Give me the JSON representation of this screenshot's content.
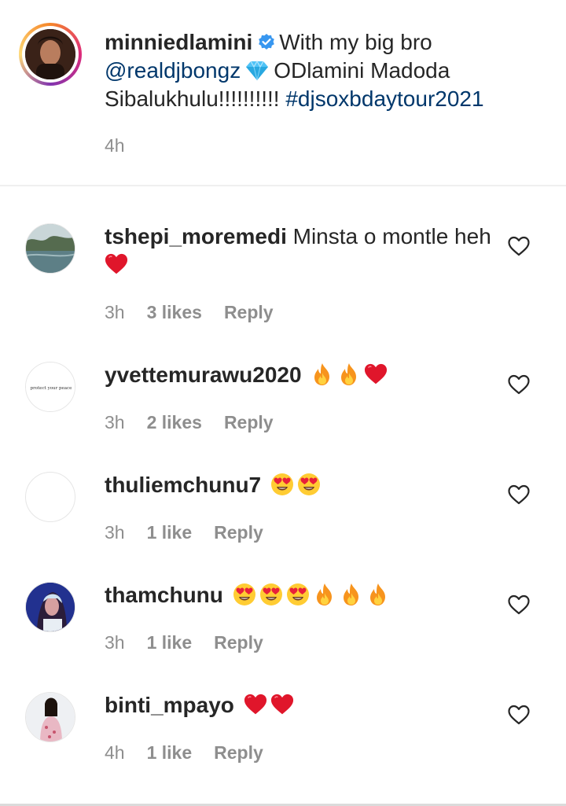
{
  "caption": {
    "username": "minniedlamini",
    "text_part1": "With my big bro",
    "mention": "@realdjbongz",
    "text_part2": "ODlamini Madoda Sibalukhulu!!!!!!!!!!",
    "hashtag": "#djsoxbdaytour2021",
    "time": "4h",
    "emoji": "gem-icon"
  },
  "comments": [
    {
      "username": "tshepi_moremedi",
      "text": "Minsta o montle heh",
      "emojis": [
        "red-heart-icon"
      ],
      "time": "3h",
      "likes": "3 likes",
      "reply": "Reply"
    },
    {
      "username": "yvettemurawu2020",
      "text": "",
      "emojis": [
        "fire-icon",
        "fire-icon",
        "red-heart-icon"
      ],
      "avatar_text": "protect your peace",
      "time": "3h",
      "likes": "2 likes",
      "reply": "Reply"
    },
    {
      "username": "thuliemchunu7",
      "text": "",
      "emojis": [
        "heart-eyes-icon",
        "heart-eyes-icon"
      ],
      "time": "3h",
      "likes": "1 like",
      "reply": "Reply"
    },
    {
      "username": "thamchunu",
      "text": "",
      "emojis": [
        "heart-eyes-icon",
        "heart-eyes-icon",
        "heart-eyes-icon",
        "fire-icon",
        "fire-icon",
        "fire-icon"
      ],
      "time": "3h",
      "likes": "1 like",
      "reply": "Reply"
    },
    {
      "username": "binti_mpayo",
      "text": "",
      "emojis": [
        "red-heart-icon",
        "red-heart-icon"
      ],
      "time": "4h",
      "likes": "1 like",
      "reply": "Reply"
    }
  ],
  "colors": {
    "text": "#262626",
    "secondary": "#8e8e8e",
    "link": "#00376b",
    "verified": "#3897f0",
    "heart": "#ed4956"
  }
}
